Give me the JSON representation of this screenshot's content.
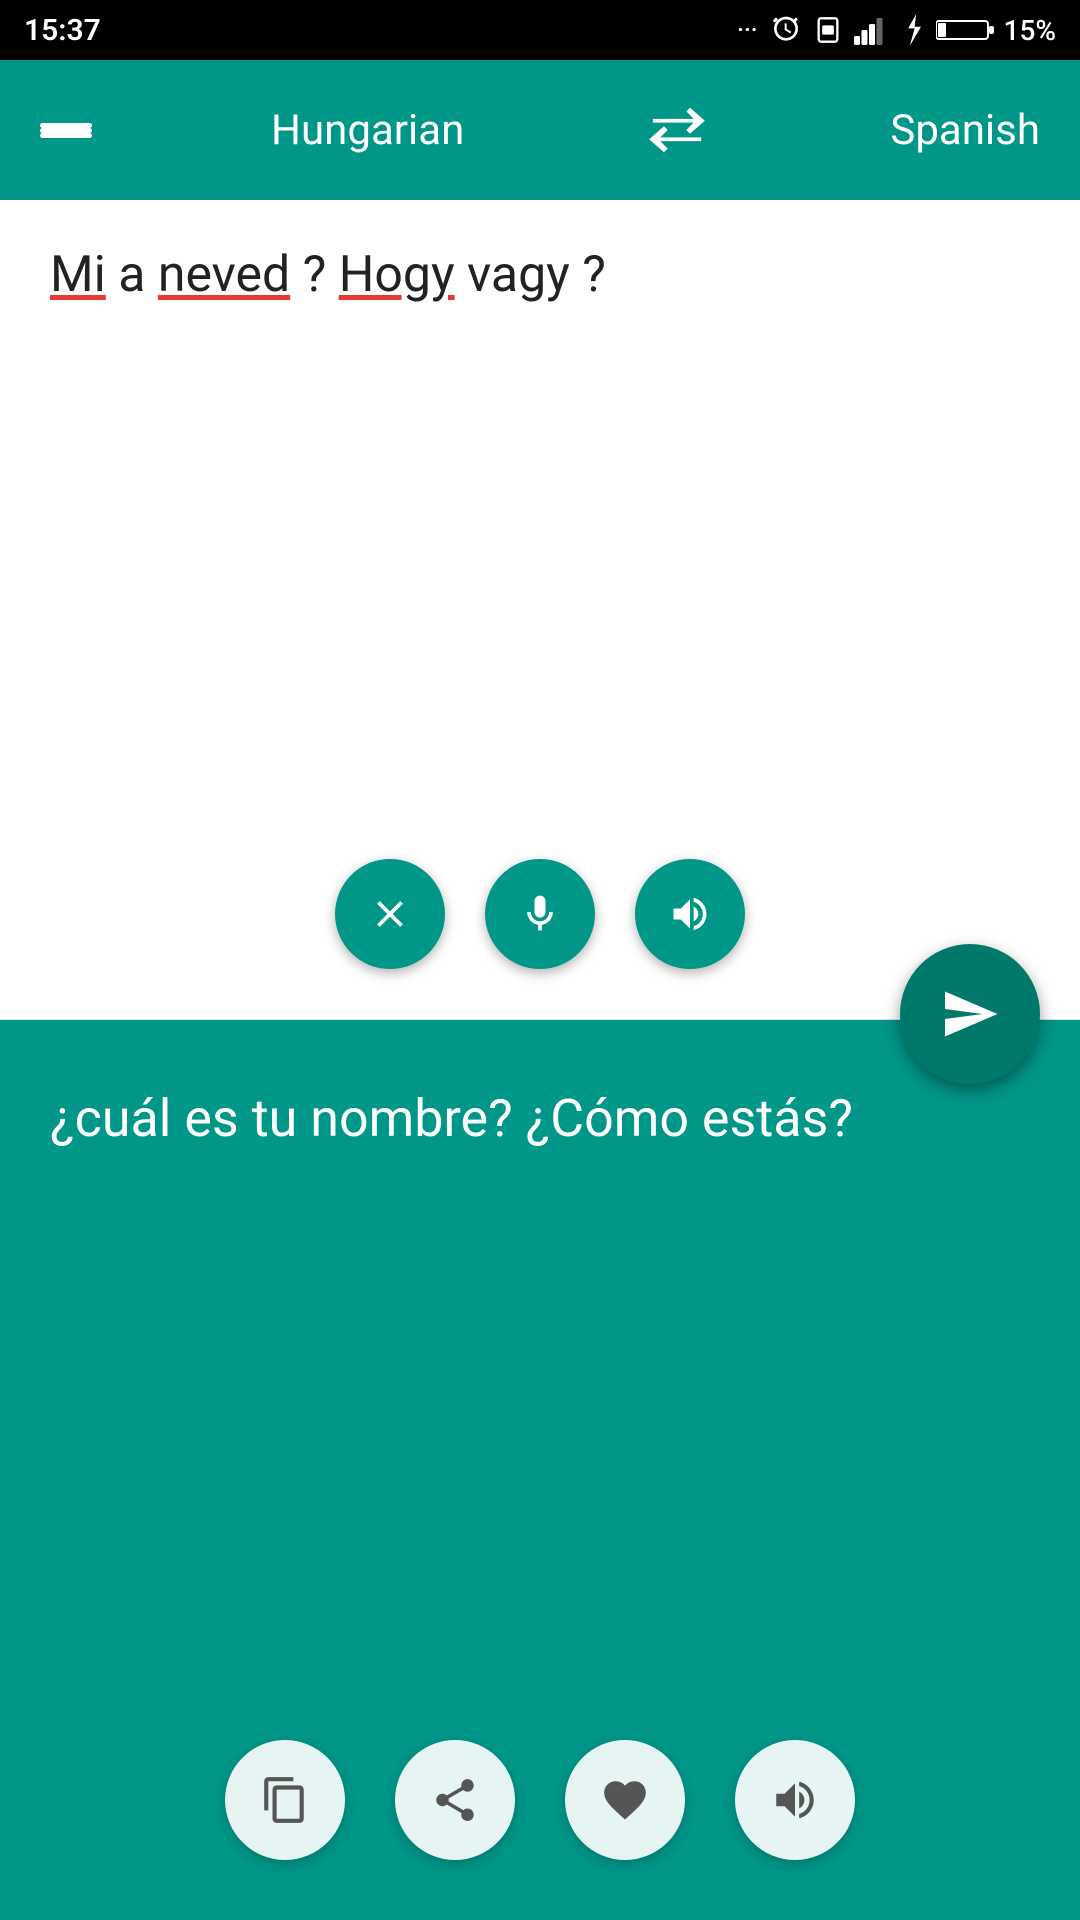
{
  "statusBar": {
    "time": "15:37",
    "battery": "15%"
  },
  "topBar": {
    "menuIcon": "menu",
    "sourceLang": "Hungarian",
    "swapIcon": "swap",
    "targetLang": "Spanish"
  },
  "inputSection": {
    "text": "Mi a neved? Hogy vagy?",
    "clearLabel": "clear",
    "micLabel": "microphone",
    "speakerLabel": "speaker",
    "sendLabel": "send"
  },
  "translationSection": {
    "text": "¿cuál es tu nombre? ¿Cómo estás?",
    "copyLabel": "copy",
    "shareLabel": "share",
    "favoriteLabel": "favorite",
    "speakerLabel": "speaker"
  }
}
